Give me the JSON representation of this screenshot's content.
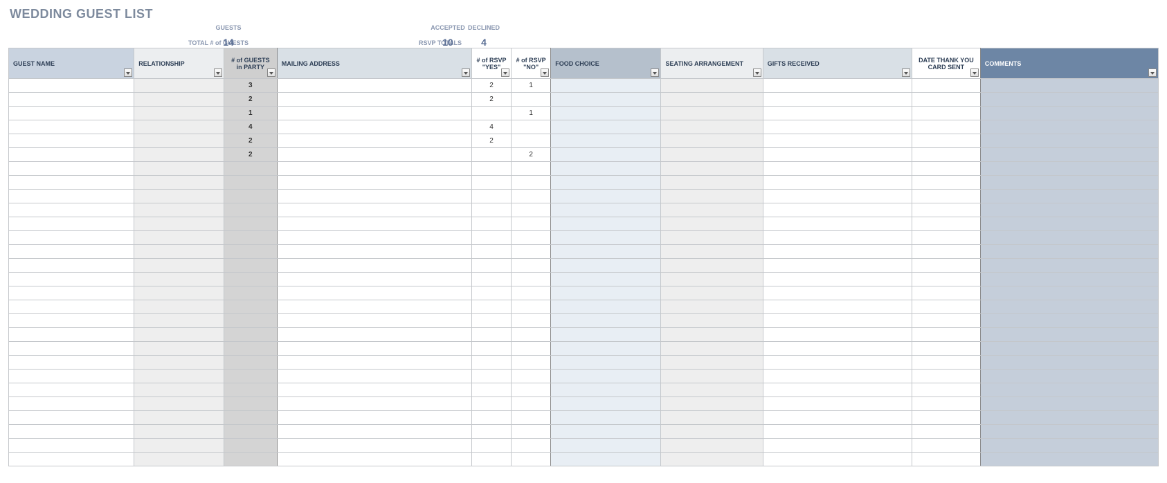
{
  "title": "WEDDING GUEST LIST",
  "summary": {
    "total_guests_label": "TOTAL # of GUESTS",
    "guests_label": "GUESTS",
    "guests_value": "14",
    "rsvp_totals_label": "RSVP TOTALS",
    "accepted_label": "ACCEPTED",
    "accepted_value": "10",
    "declined_label": "DECLINED",
    "declined_value": "4"
  },
  "columns": {
    "guest_name": "GUEST NAME",
    "relationship": "RELATIONSHIP",
    "num_guests": "# of GUESTS in PARTY",
    "mailing_address": "MAILING ADDRESS",
    "rsvp_yes": "# of RSVP \"YES\"",
    "rsvp_no": "# of RSVP \"NO\"",
    "food_choice": "FOOD CHOICE",
    "seating": "SEATING ARRANGEMENT",
    "gifts": "GIFTS RECEIVED",
    "thank_you": "DATE THANK YOU CARD SENT",
    "comments": "COMMENTS"
  },
  "rows": [
    {
      "num_guests": "3",
      "rsvp_yes": "2",
      "rsvp_no": "1"
    },
    {
      "num_guests": "2",
      "rsvp_yes": "2",
      "rsvp_no": ""
    },
    {
      "num_guests": "1",
      "rsvp_yes": "",
      "rsvp_no": "1"
    },
    {
      "num_guests": "4",
      "rsvp_yes": "4",
      "rsvp_no": ""
    },
    {
      "num_guests": "2",
      "rsvp_yes": "2",
      "rsvp_no": ""
    },
    {
      "num_guests": "2",
      "rsvp_yes": "",
      "rsvp_no": "2"
    },
    {
      "num_guests": "",
      "rsvp_yes": "",
      "rsvp_no": ""
    },
    {
      "num_guests": "",
      "rsvp_yes": "",
      "rsvp_no": ""
    },
    {
      "num_guests": "",
      "rsvp_yes": "",
      "rsvp_no": ""
    },
    {
      "num_guests": "",
      "rsvp_yes": "",
      "rsvp_no": ""
    },
    {
      "num_guests": "",
      "rsvp_yes": "",
      "rsvp_no": ""
    },
    {
      "num_guests": "",
      "rsvp_yes": "",
      "rsvp_no": ""
    },
    {
      "num_guests": "",
      "rsvp_yes": "",
      "rsvp_no": ""
    },
    {
      "num_guests": "",
      "rsvp_yes": "",
      "rsvp_no": ""
    },
    {
      "num_guests": "",
      "rsvp_yes": "",
      "rsvp_no": ""
    },
    {
      "num_guests": "",
      "rsvp_yes": "",
      "rsvp_no": ""
    },
    {
      "num_guests": "",
      "rsvp_yes": "",
      "rsvp_no": ""
    },
    {
      "num_guests": "",
      "rsvp_yes": "",
      "rsvp_no": ""
    },
    {
      "num_guests": "",
      "rsvp_yes": "",
      "rsvp_no": ""
    },
    {
      "num_guests": "",
      "rsvp_yes": "",
      "rsvp_no": ""
    },
    {
      "num_guests": "",
      "rsvp_yes": "",
      "rsvp_no": ""
    },
    {
      "num_guests": "",
      "rsvp_yes": "",
      "rsvp_no": ""
    },
    {
      "num_guests": "",
      "rsvp_yes": "",
      "rsvp_no": ""
    },
    {
      "num_guests": "",
      "rsvp_yes": "",
      "rsvp_no": ""
    },
    {
      "num_guests": "",
      "rsvp_yes": "",
      "rsvp_no": ""
    },
    {
      "num_guests": "",
      "rsvp_yes": "",
      "rsvp_no": ""
    },
    {
      "num_guests": "",
      "rsvp_yes": "",
      "rsvp_no": ""
    },
    {
      "num_guests": "",
      "rsvp_yes": "",
      "rsvp_no": ""
    }
  ]
}
